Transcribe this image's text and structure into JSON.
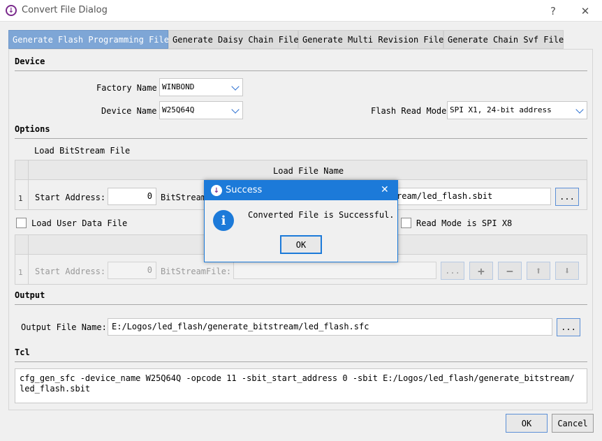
{
  "window": {
    "title": "Convert File Dialog",
    "help_label": "?",
    "close_label": "✕"
  },
  "tabs": [
    {
      "label": "Generate Flash Programming File"
    },
    {
      "label": "Generate Daisy Chain File"
    },
    {
      "label": "Generate Multi Revision File"
    },
    {
      "label": "Generate Chain Svf File"
    }
  ],
  "device": {
    "section_title": "Device",
    "factory_label": "Factory Name",
    "factory_value": "WINBOND",
    "device_label": "Device Name",
    "device_value": "W25Q64Q",
    "read_mode_label": "Flash Read Mode",
    "read_mode_value": "SPI X1, 24-bit address"
  },
  "options": {
    "section_title": "Options",
    "load_bitstream_label": "Load BitStream File",
    "table1": {
      "header": "Load File Name",
      "row_num": "1",
      "start_label": "Start Address:",
      "start_value": "0",
      "bitstream_label": "BitStream",
      "file_value": "ream/led_flash.sbit",
      "browse_label": "..."
    },
    "load_user_data_label": "Load User Data File",
    "read_mode_x8_label": "Read Mode is SPI X8",
    "table2": {
      "row_num": "1",
      "start_label": "Start Address:",
      "start_value": "0",
      "bitstream_label": "BitStreamFile:",
      "file_value": "",
      "browse_label": "...",
      "add_label": "+",
      "remove_label": "−",
      "up_label": "⬆",
      "down_label": "⬇"
    }
  },
  "output": {
    "section_title": "Output",
    "file_label": "Output File Name:",
    "file_value": "E:/Logos/led_flash/generate_bitstream/led_flash.sfc",
    "browse_label": "..."
  },
  "tcl": {
    "section_title": "Tcl",
    "line1": "cfg_gen_sfc -device_name W25Q64Q -opcode 11 -sbit_start_address 0 -sbit E:/Logos/led_flash/generate_bitstream/",
    "line2": "led_flash.sbit"
  },
  "footer": {
    "ok_label": "OK",
    "cancel_label": "Cancel"
  },
  "modal": {
    "title": "Success",
    "close_label": "✕",
    "message": "Converted File is Successful.",
    "info_glyph": "i",
    "ok_label": "OK"
  },
  "colors": {
    "accent": "#1c7ad9",
    "tab_active": "#7ea6d6",
    "app_icon": "#7a2a8c"
  }
}
